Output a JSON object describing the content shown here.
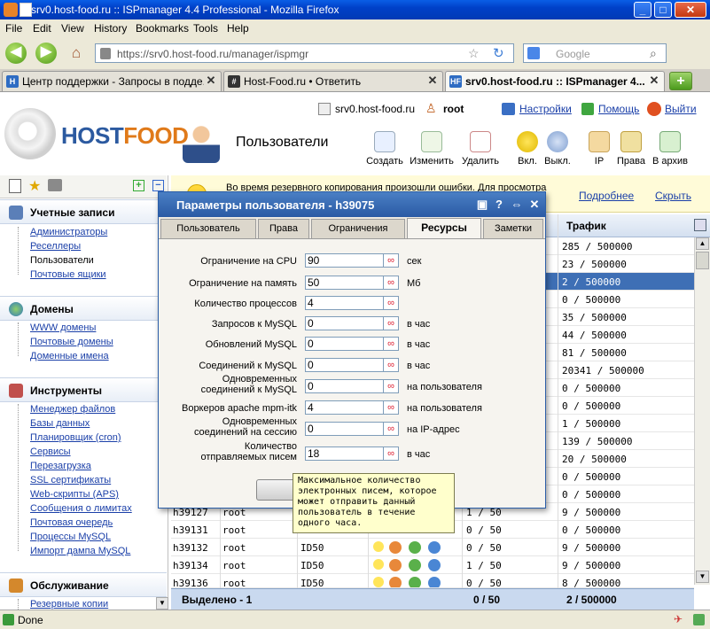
{
  "window": {
    "title": "srv0.host-food.ru :: ISPmanager 4.4 Professional - Mozilla Firefox"
  },
  "menubar": [
    "File",
    "Edit",
    "View",
    "History",
    "Bookmarks",
    "Tools",
    "Help"
  ],
  "navbar": {
    "url": "https://srv0.host-food.ru/manager/ispmgr",
    "search_placeholder": "Google"
  },
  "tabs": [
    {
      "label": "Центр поддержки - Запросы в подде...",
      "active": false
    },
    {
      "label": "Host-Food.ru • Ответить",
      "active": false
    },
    {
      "label": "srv0.host-food.ru :: ISPmanager 4...",
      "active": true
    }
  ],
  "header": {
    "server": "srv0.host-food.ru",
    "user": "root",
    "settings": "Настройки",
    "help": "Помощь",
    "logout": "Выйти",
    "logo_a": "HOST",
    "logo_b": "FOOD",
    "page_title": "Пользователи"
  },
  "toolbar": {
    "create": "Создать",
    "edit": "Изменить",
    "delete": "Удалить",
    "enable": "Вкл.",
    "disable": "Выкл.",
    "ip": "IP",
    "rights": "Права",
    "archive": "В архив"
  },
  "sidebar": {
    "accounts": {
      "title": "Учетные записи",
      "items": [
        "Администраторы",
        "Реселлеры",
        "Пользователи",
        "Почтовые ящики"
      ]
    },
    "domains": {
      "title": "Домены",
      "items": [
        "WWW домены",
        "Почтовые домены",
        "Доменные имена"
      ]
    },
    "tools": {
      "title": "Инструменты",
      "items": [
        "Менеджер файлов",
        "Базы данных",
        "Планировщик (cron)",
        "Сервисы",
        "Перезагрузка",
        "SSL сертификаты",
        "Web-скрипты (APS)",
        "Сообщения о лимитах",
        "Почтовая очередь",
        "Процессы MySQL",
        "Импорт дампа MySQL"
      ]
    },
    "service": {
      "title": "Обслуживание",
      "items": [
        "Резервные копии"
      ]
    }
  },
  "warning": {
    "text": "Во время резервного копирования произошли ошибки. Для просмотра",
    "more": "Подробнее",
    "hide": "Скрыть"
  },
  "table": {
    "traffic_header": "Трафик",
    "traffic": [
      "285 / 500000",
      "23 / 500000",
      "2 / 500000",
      "0 / 500000",
      "35 / 500000",
      "44 / 500000",
      "81 / 500000",
      "20341 / 500000",
      "0 / 500000",
      "0 / 500000",
      "1 / 500000",
      "139 / 500000",
      "20 / 500000",
      "0 / 500000",
      "0 / 500000",
      "9 / 500000",
      "0 / 500000",
      "9 / 500000",
      "9 / 500000",
      "8 / 500000"
    ],
    "rows": [
      {
        "name": "h39127",
        "owner": "root",
        "ip": "",
        "q": "1 / 50",
        "traffic": "9 / 500000"
      },
      {
        "name": "h39131",
        "owner": "root",
        "ip": "",
        "q": "0 / 50",
        "traffic": "0 / 500000"
      },
      {
        "name": "h39132",
        "owner": "root",
        "ip": "ID50",
        "q": "0 / 50",
        "traffic": "9 / 500000"
      },
      {
        "name": "h39134",
        "owner": "root",
        "ip": "ID50",
        "q": "1 / 50",
        "traffic": "9 / 500000"
      },
      {
        "name": "h39136",
        "owner": "root",
        "ip": "ID50",
        "q": "0 / 50",
        "traffic": "8 / 500000"
      }
    ],
    "footer": {
      "selected": "Выделено - 1",
      "quota": "0 / 50",
      "traffic": "2 / 500000"
    }
  },
  "modal": {
    "title": "Параметры пользователя - h39075",
    "tabs": [
      "Пользователь",
      "Права",
      "Ограничения",
      "Ресурсы",
      "Заметки"
    ],
    "fields": [
      {
        "label": "Ограничение на CPU",
        "value": "90",
        "unit": "сек"
      },
      {
        "label": "Ограничение на память",
        "value": "50",
        "unit": "Мб"
      },
      {
        "label": "Количество процессов",
        "value": "4",
        "unit": ""
      },
      {
        "label": "Запросов к MySQL",
        "value": "0",
        "unit": "в час"
      },
      {
        "label": "Обновлений MySQL",
        "value": "0",
        "unit": "в час"
      },
      {
        "label": "Соединений к MySQL",
        "value": "0",
        "unit": "в час"
      },
      {
        "label": "Одновременных соединений к MySQL",
        "value": "0",
        "unit": "на пользователя"
      },
      {
        "label": "Воркеров apache mpm-itk",
        "value": "4",
        "unit": "на пользователя"
      },
      {
        "label": "Одновременных соединений на сессию",
        "value": "0",
        "unit": "на IP-адрес"
      },
      {
        "label": "Количество отправляемых писем",
        "value": "18",
        "unit": "в час"
      }
    ],
    "inf_symbol": "∞"
  },
  "tooltip": {
    "text": "Максимальное количество электронных писем, которое может отправить данный пользователь в течение одного часа."
  },
  "status": {
    "text": "Done"
  }
}
